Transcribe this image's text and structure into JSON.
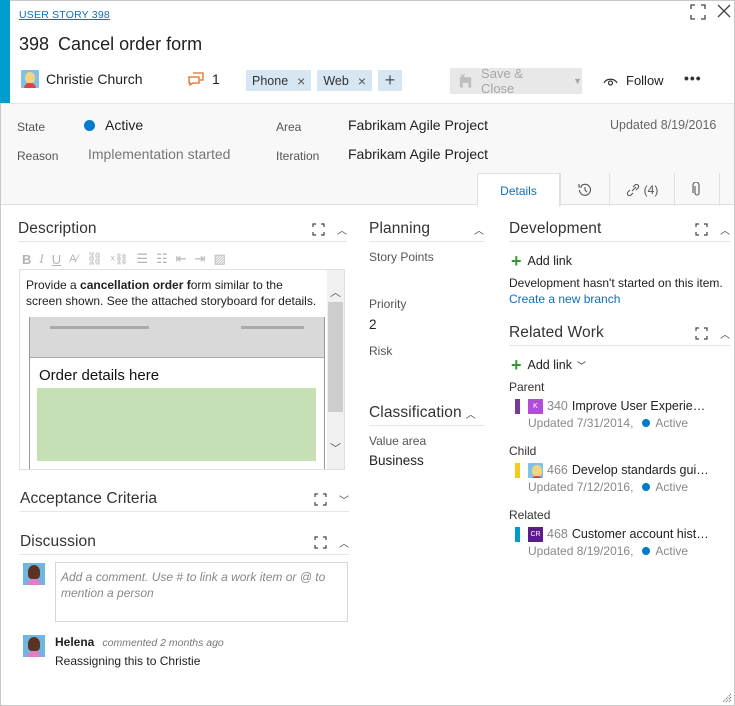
{
  "header": {
    "work_item_type": "USER STORY 398",
    "id": "398",
    "title": "Cancel order form",
    "assigned_to": "Christie Church",
    "comment_count": "1",
    "tags": [
      "Phone",
      "Web"
    ],
    "tag_remove_glyph": "×",
    "tag_add_glyph": "+",
    "save_close_label": "Save & Close",
    "follow_label": "Follow",
    "more_label": "•••"
  },
  "fields": {
    "state_label": "State",
    "state_value": "Active",
    "state_color": "#007acc",
    "reason_label": "Reason",
    "reason_value": "Implementation started",
    "area_label": "Area",
    "area_value": "Fabrikam Agile Project",
    "iteration_label": "Iteration",
    "iteration_value": "Fabrikam Agile Project",
    "updated": "Updated 8/19/2016"
  },
  "tabs": {
    "details": "Details",
    "links": "(4)"
  },
  "description": {
    "title": "Description",
    "text_before": "Provide a ",
    "text_bold1": "cancellation order f",
    "text_after": "orm similar to the screen shown. See the attached storyboard for details.",
    "mock_label": "Order details here"
  },
  "acceptance": {
    "title": "Acceptance Criteria"
  },
  "discussion": {
    "title": "Discussion",
    "placeholder": "Add a comment. Use # to link a work item or @ to mention a person",
    "comments": [
      {
        "author": "Helena",
        "meta": "commented 2 months ago",
        "text": "Reassigning this to Christie"
      }
    ]
  },
  "planning": {
    "title": "Planning",
    "story_points_label": "Story Points",
    "story_points_value": "",
    "priority_label": "Priority",
    "priority_value": "2",
    "risk_label": "Risk",
    "risk_value": ""
  },
  "classification": {
    "title": "Classification",
    "value_area_label": "Value area",
    "value_area_value": "Business"
  },
  "development": {
    "title": "Development",
    "add_link": "Add link",
    "status_text": "Development hasn't started on this item.",
    "create_branch": "Create a new branch"
  },
  "related_work": {
    "title": "Related Work",
    "add_link": "Add link",
    "groups": [
      {
        "label": "Parent",
        "id": "340",
        "title": "Improve User Experience",
        "updated": "Updated 7/31/2014,",
        "state": "Active",
        "color": "#773b93",
        "icon_text": "K",
        "icon_color": "#b24ed6"
      },
      {
        "label": "Child",
        "id": "466",
        "title": "Develop standards guid...",
        "updated": "Updated 7/12/2016,",
        "state": "Active",
        "color": "#f2cb1d",
        "icon_text": "",
        "icon_color": "#7fc1e8"
      },
      {
        "label": "Related",
        "id": "468",
        "title": "Customer account history",
        "updated": "Updated 8/19/2016,",
        "state": "Active",
        "color": "#009ccc",
        "icon_text": "CR",
        "icon_color": "#5c1a8a"
      }
    ]
  }
}
